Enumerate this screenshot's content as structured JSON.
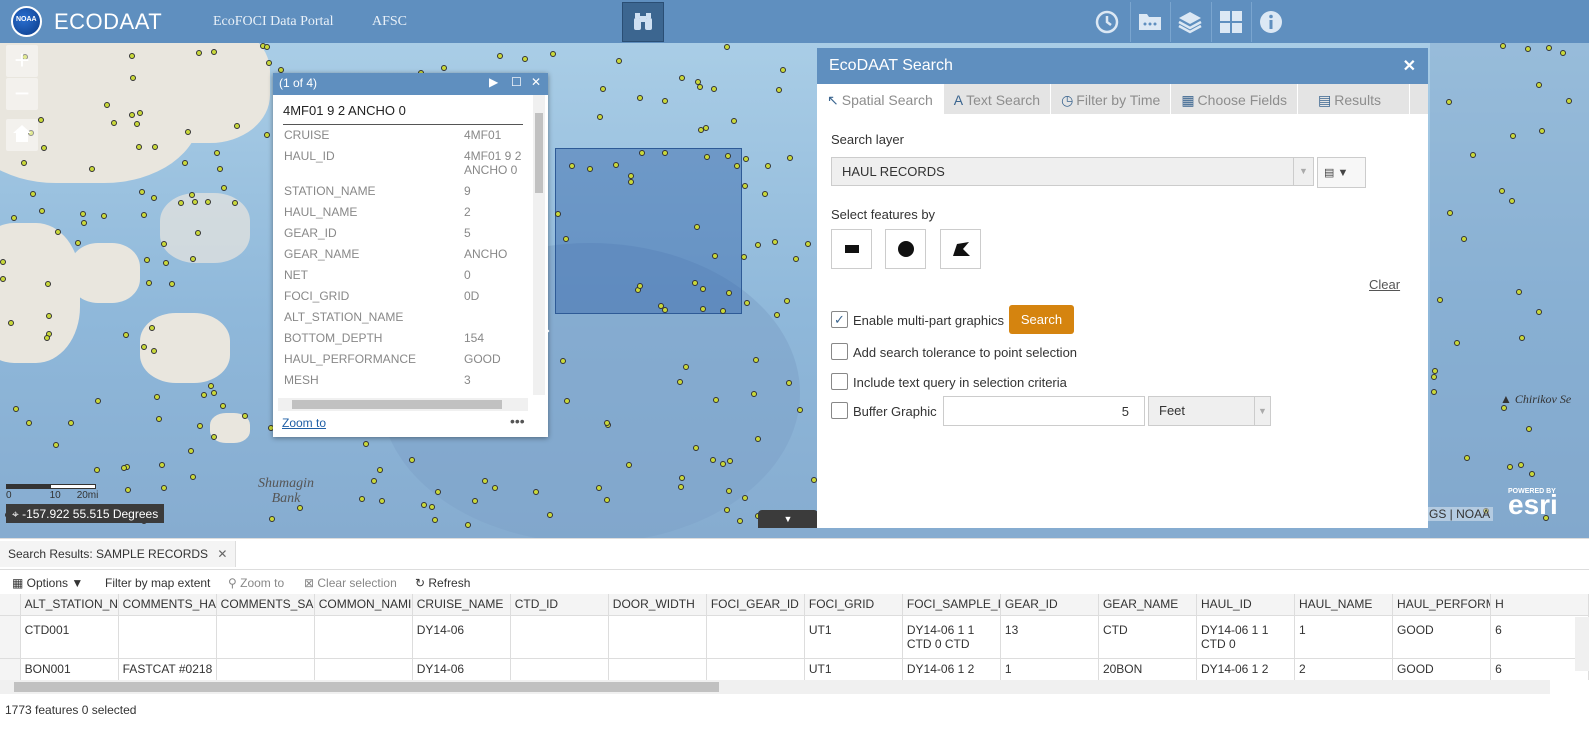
{
  "header": {
    "app_title": "ECODAAT",
    "logo_text": "NOAA",
    "links": [
      "EcoFOCI Data Portal",
      "AFSC"
    ],
    "icons": [
      "binoculars-icon",
      "history-icon",
      "data-folder-icon",
      "layers-icon",
      "grid-icon",
      "info-icon"
    ]
  },
  "map": {
    "zoom_in": "+",
    "zoom_out": "−",
    "scale_labels": [
      "0",
      "10",
      "20mi"
    ],
    "coords": "-157.922 55.515 Degrees",
    "place_label": "Shumagin Bank",
    "place_label_2": "Chirikov Se",
    "attribution": "GS | NOAA",
    "esri_powered": "POWERED BY",
    "esri": "esri"
  },
  "popup": {
    "counter": "(1 of 4)",
    "title": "4MF01 9 2 ANCHO 0",
    "rows": [
      {
        "k": "CRUISE",
        "v": "4MF01"
      },
      {
        "k": "HAUL_ID",
        "v": "4MF01 9 2 ANCHO 0"
      },
      {
        "k": "STATION_NAME",
        "v": "9"
      },
      {
        "k": "HAUL_NAME",
        "v": "2"
      },
      {
        "k": "GEAR_ID",
        "v": "5"
      },
      {
        "k": "GEAR_NAME",
        "v": "ANCHO"
      },
      {
        "k": "NET",
        "v": "0"
      },
      {
        "k": "FOCI_GRID",
        "v": "0D"
      },
      {
        "k": "ALT_STATION_NAME",
        "v": ""
      },
      {
        "k": "BOTTOM_DEPTH",
        "v": "154"
      },
      {
        "k": "HAUL_PERFORMANCE",
        "v": "GOOD"
      },
      {
        "k": "MESH",
        "v": "3"
      }
    ],
    "zoom_to": "Zoom to",
    "more": "•••"
  },
  "search_panel": {
    "title": "EcoDAAT Search",
    "tabs": [
      "Spatial Search",
      "Text Search",
      "Filter by Time",
      "Choose Fields",
      "Results"
    ],
    "search_layer_label": "Search layer",
    "search_layer_value": "HAUL RECORDS",
    "select_features_label": "Select features by",
    "clear": "Clear",
    "enable_multipart": "Enable multi-part graphics",
    "search_button": "Search",
    "add_tolerance": "Add search tolerance to point selection",
    "include_text_query": "Include text query in selection criteria",
    "buffer_graphic": "Buffer Graphic",
    "buffer_value": "5",
    "buffer_unit": "Feet"
  },
  "results": {
    "tab_label": "Search Results: SAMPLE RECORDS",
    "toolbar": {
      "options": "Options",
      "filter_by_extent": "Filter by map extent",
      "zoom_to": "Zoom to",
      "clear_selection": "Clear selection",
      "refresh": "Refresh"
    },
    "columns": [
      "ALT_STATION_NA",
      "COMMENTS_HAI",
      "COMMENTS_SAI",
      "COMMON_NAMI",
      "CRUISE_NAME",
      "CTD_ID",
      "DOOR_WIDTH",
      "FOCI_GEAR_ID",
      "FOCI_GRID",
      "FOCI_SAMPLE_ID",
      "GEAR_ID",
      "GEAR_NAME",
      "HAUL_ID",
      "HAUL_NAME",
      "HAUL_PERFORM.",
      "H"
    ],
    "rows": [
      [
        "CTD001",
        "",
        "",
        "",
        "DY14-06",
        "",
        "",
        "",
        "UT1",
        "DY14-06 1 1 CTD 0 CTD",
        "13",
        "CTD",
        "DY14-06 1 1 CTD 0",
        "1",
        "GOOD",
        "6"
      ],
      [
        "BON001",
        "FASTCAT #0218",
        "",
        "",
        "DY14-06",
        "",
        "",
        "",
        "UT1",
        "DY14-06 1 2",
        "1",
        "20BON",
        "DY14-06 1 2",
        "2",
        "GOOD",
        "6"
      ]
    ],
    "status": "1773 features 0 selected"
  }
}
